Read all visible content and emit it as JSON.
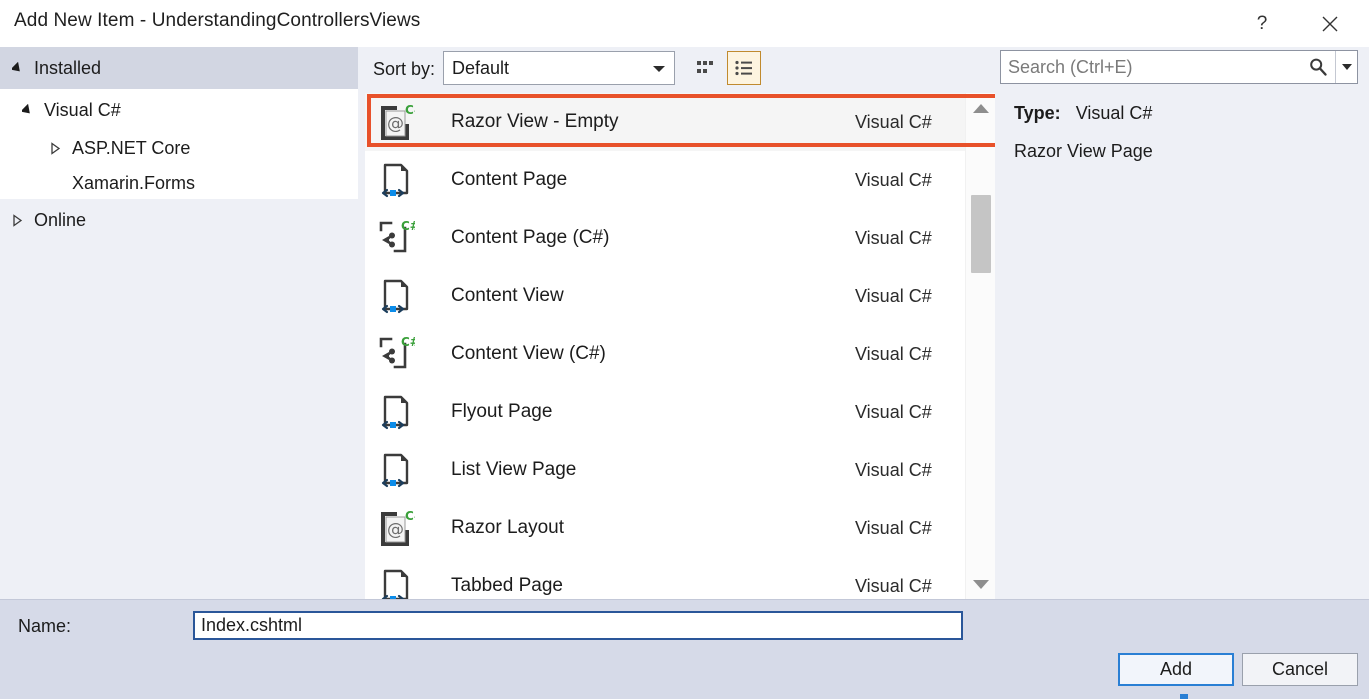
{
  "window": {
    "title": "Add New Item - UnderstandingControllersViews",
    "help_label": "?",
    "close_label": "✕"
  },
  "tree": {
    "installed_label": "Installed",
    "online_label": "Online",
    "nodes": [
      {
        "label": "Visual C#",
        "state": "expanded"
      },
      {
        "label": "ASP.NET Core",
        "state": "collapsed"
      },
      {
        "label": "Xamarin.Forms",
        "state": "leaf"
      }
    ]
  },
  "toolbar": {
    "sort_label": "Sort by:",
    "sort_value": "Default",
    "sort_options": [
      "Default"
    ],
    "grid_view_icon": "grid-view-icon",
    "list_view_icon": "list-view-icon",
    "active_view": "list"
  },
  "search": {
    "placeholder": "Search (Ctrl+E)",
    "value": "",
    "icon": "search-icon",
    "dropdown_icon": "chevron-down-icon"
  },
  "list": {
    "items": [
      {
        "name": "Razor View - Empty",
        "type": "Visual C#",
        "icon": "razor-file-icon",
        "selected": true
      },
      {
        "name": "Content Page",
        "type": "Visual C#",
        "icon": "xaml-page-icon",
        "selected": false
      },
      {
        "name": "Content Page (C#)",
        "type": "Visual C#",
        "icon": "csharp-class-icon",
        "selected": false
      },
      {
        "name": "Content View",
        "type": "Visual C#",
        "icon": "xaml-page-icon",
        "selected": false
      },
      {
        "name": "Content View (C#)",
        "type": "Visual C#",
        "icon": "csharp-class-icon",
        "selected": false
      },
      {
        "name": "Flyout Page",
        "type": "Visual C#",
        "icon": "xaml-page-icon",
        "selected": false
      },
      {
        "name": "List View Page",
        "type": "Visual C#",
        "icon": "xaml-page-icon",
        "selected": false
      },
      {
        "name": "Razor Layout",
        "type": "Visual C#",
        "icon": "razor-file-icon",
        "selected": false
      },
      {
        "name": "Tabbed Page",
        "type": "Visual C#",
        "icon": "xaml-page-icon",
        "selected": false
      }
    ]
  },
  "detail": {
    "type_key": "Type:",
    "type_value": "Visual C#",
    "description": "Razor View Page"
  },
  "footer": {
    "name_label": "Name:",
    "name_value": "Index.cshtml",
    "add_label": "Add",
    "cancel_label": "Cancel"
  },
  "colors": {
    "annotation": "#e8512a",
    "accent_blue": "#2a7fd4",
    "selected_toggle_border": "#c08a2e",
    "csharp_green": "#3aa03a",
    "xaml_blue": "#0c8ce9"
  }
}
